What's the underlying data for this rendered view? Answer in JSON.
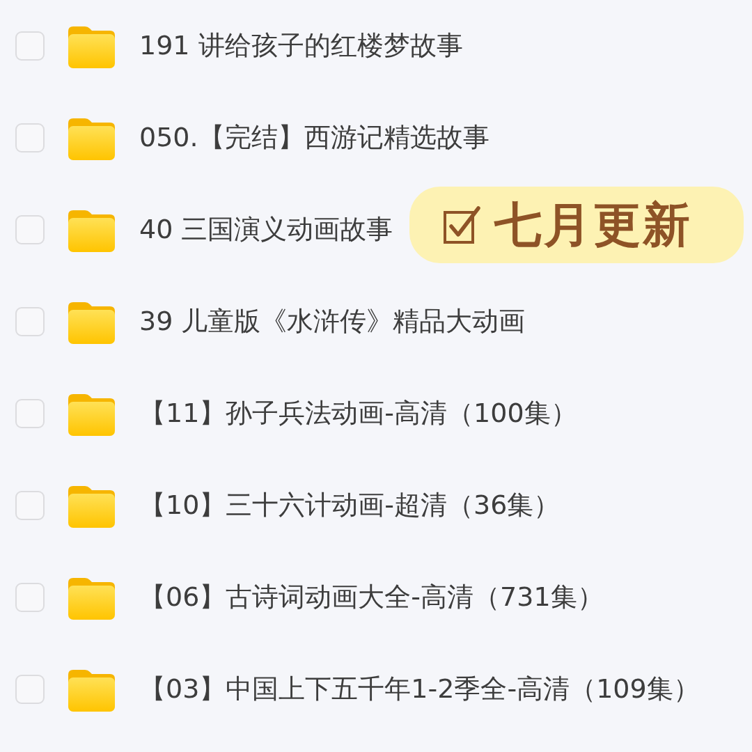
{
  "files": [
    {
      "name": "191 讲给孩子的红楼梦故事",
      "checked": false
    },
    {
      "name": "050.【完结】西游记精选故事",
      "checked": false
    },
    {
      "name": "40 三国演义动画故事",
      "checked": false
    },
    {
      "name": "39 儿童版《水浒传》精品大动画",
      "checked": false
    },
    {
      "name": "【11】孙子兵法动画-高清（100集）",
      "checked": false
    },
    {
      "name": "【10】三十六计动画-超清（36集）",
      "checked": false
    },
    {
      "name": "【06】古诗词动画大全-高清（731集）",
      "checked": false
    },
    {
      "name": "【03】中国上下五千年1-2季全-高清（109集）",
      "checked": false
    }
  ],
  "badge": {
    "label": "七月更新"
  }
}
